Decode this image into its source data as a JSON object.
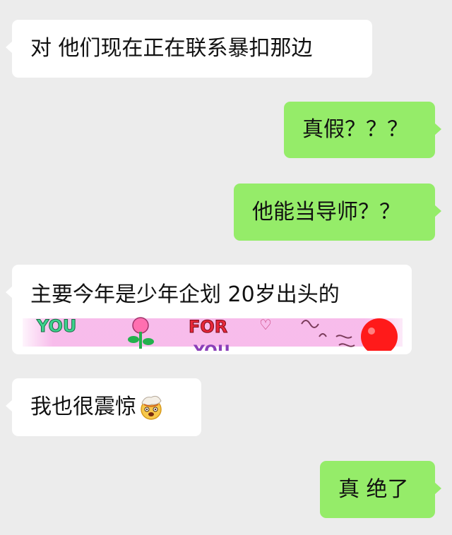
{
  "chat": {
    "messages": [
      {
        "side": "left",
        "text": "对 他们现在正在联系暴扣那边"
      },
      {
        "side": "right",
        "text": "真假？？？"
      },
      {
        "side": "right",
        "text": "他能当导师？？"
      },
      {
        "side": "left",
        "text": "主要今年是少年企划 20岁出头的",
        "sticker": {
          "text_1": "YOU",
          "text_2": "FOR",
          "text_3": "YOU",
          "symbol": "♡"
        }
      },
      {
        "side": "left",
        "text": "我也很震惊",
        "emoji": "exploding-head-emoji"
      },
      {
        "side": "right",
        "text": "真 绝了"
      }
    ]
  },
  "colors": {
    "background": "#ececec",
    "incoming_bubble": "#ffffff",
    "outgoing_bubble": "#95ec69",
    "sticker_pink": "#f7b8ea",
    "sticker_red": "#ff1a1a"
  }
}
